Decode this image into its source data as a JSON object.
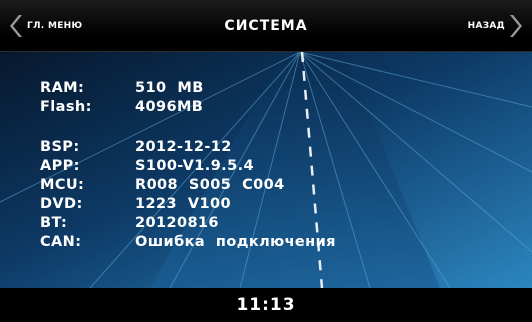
{
  "header": {
    "back_menu_label": "ГЛ. МЕНЮ",
    "title": "СИСТЕМА",
    "back_label": "НАЗАД"
  },
  "info": [
    {
      "label": "RAM:",
      "value": "510  MB"
    },
    {
      "label": "Flash:",
      "value": "4096MB"
    },
    {
      "label": "BSP:",
      "value": "2012-12-12"
    },
    {
      "label": "APP:",
      "value": "S100-V1.9.5.4"
    },
    {
      "label": "MCU:",
      "value": "R008  S005  C004"
    },
    {
      "label": "DVD:",
      "value": "1223  V100"
    },
    {
      "label": "BT:",
      "value": "20120816"
    },
    {
      "label": "CAN:",
      "value": "Ошибка  подключения"
    }
  ],
  "footer": {
    "time": "11:13"
  }
}
